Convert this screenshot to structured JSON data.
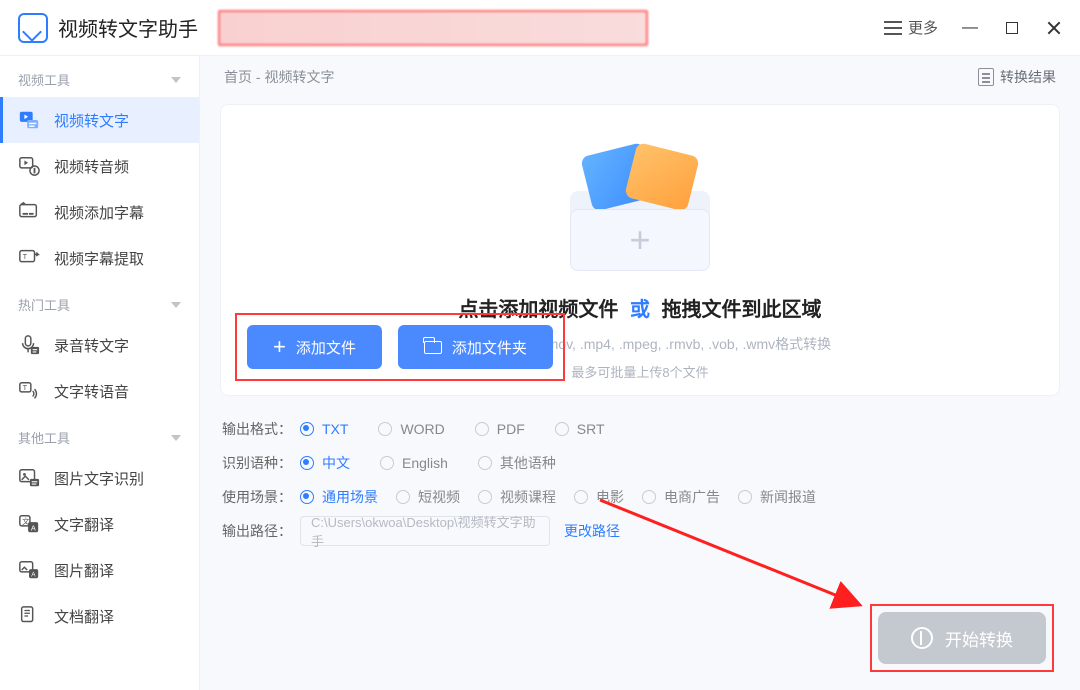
{
  "app": {
    "title": "视频转文字助手",
    "more": "更多"
  },
  "sidebar": {
    "groups": [
      {
        "label": "视频工具",
        "items": [
          {
            "label": "视频转文字"
          },
          {
            "label": "视频转音频"
          },
          {
            "label": "视频添加字幕"
          },
          {
            "label": "视频字幕提取"
          }
        ]
      },
      {
        "label": "热门工具",
        "items": [
          {
            "label": "录音转文字"
          },
          {
            "label": "文字转语音"
          }
        ]
      },
      {
        "label": "其他工具",
        "items": [
          {
            "label": "图片文字识别"
          },
          {
            "label": "文字翻译"
          },
          {
            "label": "图片翻译"
          },
          {
            "label": "文档翻译"
          }
        ]
      }
    ]
  },
  "crumbs": {
    "home": "首页",
    "sep": " - ",
    "current": "视频转文字",
    "results": "转换结果"
  },
  "drop": {
    "title_left": "点击添加视频文件",
    "or": "或",
    "title_right": "拖拽文件到此区域",
    "formats": "支持.avi, .mkv, .mov, .mp4, .mpeg, .rmvb, .vob, .wmv格式转换",
    "limit": "最多可批量上传8个文件",
    "add_file": "添加文件",
    "add_folder": "添加文件夹"
  },
  "options": {
    "out_format": {
      "label": "输出格式：",
      "items": [
        "TXT",
        "WORD",
        "PDF",
        "SRT"
      ],
      "selected": "TXT"
    },
    "language": {
      "label": "识别语种：",
      "items": [
        "中文",
        "English",
        "其他语种"
      ],
      "selected": "中文"
    },
    "scene": {
      "label": "使用场景：",
      "items": [
        "通用场景",
        "短视频",
        "视频课程",
        "电影",
        "电商广告",
        "新闻报道"
      ],
      "selected": "通用场景"
    },
    "out_path": {
      "label": "输出路径：",
      "value": "C:\\Users\\okwoa\\Desktop\\视频转文字助手",
      "change": "更改路径"
    }
  },
  "start": {
    "label": "开始转换"
  }
}
